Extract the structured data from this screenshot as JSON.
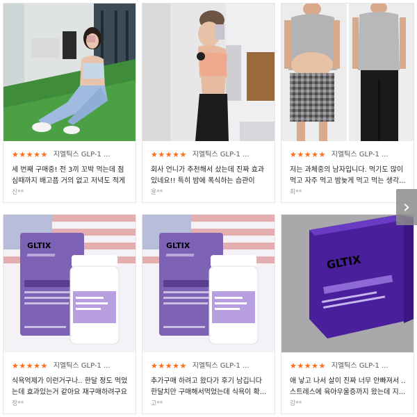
{
  "reviews": [
    {
      "stars": "★★★★★",
      "product": "지엘틱스 GLP-1 ...",
      "text": "세 번째 구매중! 전 3끼 꼬박 먹는데 점심때까지 배고픔 거의 없고 저녁도 적게 ...",
      "author": "신**",
      "image": "gym-mirror-selfie"
    },
    {
      "stars": "★★★★★",
      "product": "지엘틱스 GLP-1 ...",
      "text": "회사 언니가 추천해서 샀는데 진짜 효과 있네요!! 특히 밤에 폭식하는 습관이 있...",
      "author": "윤**",
      "image": "fitness-selfie"
    },
    {
      "stars": "★★★★★",
      "product": "지엘틱스 GLP-1 ...",
      "text": "저는 과체중의 남자입니다. 먹기도 많이 먹고 자주 먹고 밤늦게 먹고 먹는 생각...",
      "author": "최**",
      "image": "before-after-man"
    },
    {
      "stars": "★★★★★",
      "product": "지엘틱스 GLP-1 ...",
      "text": "식욕억제가 이런거구나.. 한달 정도 먹었는데 효과있는거 같아요 재구매하려구요",
      "author": "정**",
      "image": "product-bottle-flag"
    },
    {
      "stars": "★★★★★",
      "product": "지엘틱스 GLP-1 ...",
      "text": "추가구매 하려고 왔다가 후기 남깁니다 한달치만 구매해서먹었는데 식욕이 확...",
      "author": "고**",
      "image": "product-bottle-flag"
    },
    {
      "stars": "★★★★★",
      "product": "지엘틱스 GLP-1 ...",
      "text": "애 낳고 나서 살이 진짜 너무 안빠져서 .. 스트레스에 육아우울증까지 왔는데 지...",
      "author": "강**",
      "image": "product-box-photo"
    }
  ],
  "product_art": {
    "brand": "GLTIX",
    "box_brand": "GLTIX"
  },
  "colors": {
    "star": "#ff6a13",
    "product_purple": "#7e62b5",
    "box_purple": "#4a1f9c"
  },
  "icons": {
    "next": "chevron-right-icon"
  }
}
